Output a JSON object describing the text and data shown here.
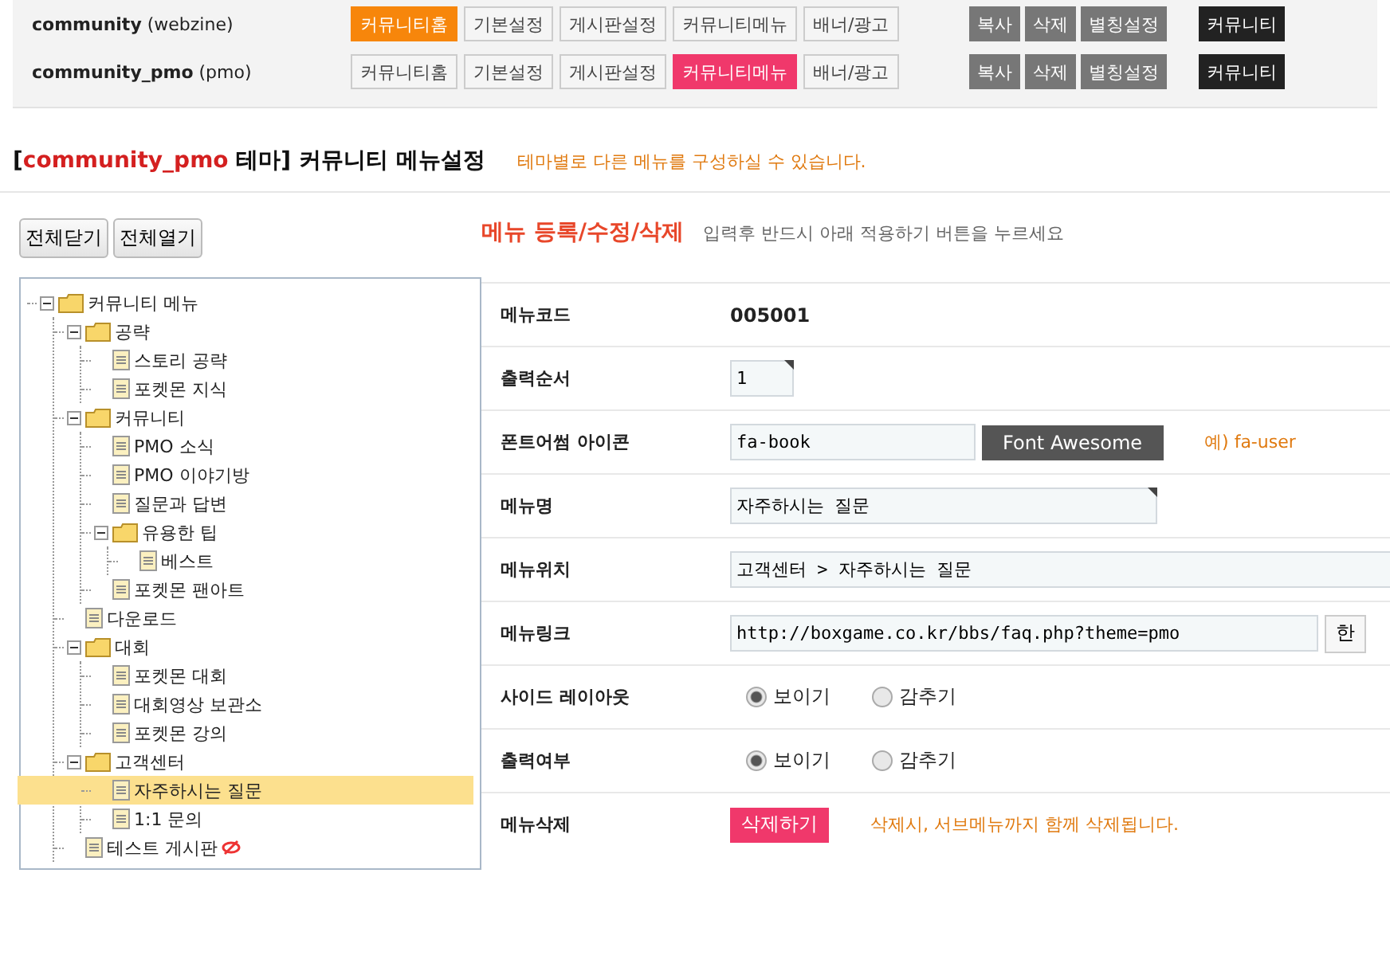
{
  "themes": [
    {
      "name": "community",
      "type": "(webzine)",
      "color": "#f7860b",
      "tabs": [
        {
          "label": "커뮤니티홈",
          "selected": true
        },
        {
          "label": "기본설정",
          "selected": false
        },
        {
          "label": "게시판설정",
          "selected": false
        },
        {
          "label": "커뮤니티메뉴",
          "selected": false
        },
        {
          "label": "배너/광고",
          "selected": false
        }
      ],
      "actions": [
        {
          "label": "복사",
          "kind": "gray"
        },
        {
          "label": "삭제",
          "kind": "gray"
        },
        {
          "label": "별칭설정",
          "kind": "gray"
        },
        {
          "label": "커뮤니티",
          "kind": "dark"
        }
      ]
    },
    {
      "name": "community_pmo",
      "type": "(pmo)",
      "color": "#f0386b",
      "tabs": [
        {
          "label": "커뮤니티홈",
          "selected": false
        },
        {
          "label": "기본설정",
          "selected": false
        },
        {
          "label": "게시판설정",
          "selected": false
        },
        {
          "label": "커뮤니티메뉴",
          "selected": true
        },
        {
          "label": "배너/광고",
          "selected": false
        }
      ],
      "actions": [
        {
          "label": "복사",
          "kind": "gray"
        },
        {
          "label": "삭제",
          "kind": "gray"
        },
        {
          "label": "별칭설정",
          "kind": "gray"
        },
        {
          "label": "커뮤니티",
          "kind": "dark"
        }
      ]
    }
  ],
  "heading": {
    "open": "[",
    "theme": "community_pmo",
    "title": "테마] 커뮤니티 메뉴설정",
    "note": "테마별로 다른 메뉴를 구성하실 수 있습니다."
  },
  "tree_buttons": [
    "전체닫기",
    "전체열기"
  ],
  "tree": [
    {
      "label": "커뮤니티 메뉴",
      "kind": "folder",
      "selected": false,
      "hidden": false,
      "children": [
        {
          "label": "공략",
          "kind": "folder",
          "selected": false,
          "hidden": false,
          "children": [
            {
              "label": "스토리 공략",
              "kind": "page",
              "selected": false,
              "hidden": false
            },
            {
              "label": "포켓몬 지식",
              "kind": "page",
              "selected": false,
              "hidden": false
            }
          ]
        },
        {
          "label": "커뮤니티",
          "kind": "folder",
          "selected": false,
          "hidden": false,
          "children": [
            {
              "label": "PMO 소식",
              "kind": "page",
              "selected": false,
              "hidden": false
            },
            {
              "label": "PMO 이야기방",
              "kind": "page",
              "selected": false,
              "hidden": false
            },
            {
              "label": "질문과 답변",
              "kind": "page",
              "selected": false,
              "hidden": false
            },
            {
              "label": "유용한 팁",
              "kind": "folder",
              "selected": false,
              "hidden": false,
              "children": [
                {
                  "label": "베스트",
                  "kind": "page",
                  "selected": false,
                  "hidden": false
                }
              ]
            },
            {
              "label": "포켓몬 팬아트",
              "kind": "page",
              "selected": false,
              "hidden": false
            }
          ]
        },
        {
          "label": "다운로드",
          "kind": "page",
          "selected": false,
          "hidden": false
        },
        {
          "label": "대회",
          "kind": "folder",
          "selected": false,
          "hidden": false,
          "children": [
            {
              "label": "포켓몬 대회",
              "kind": "page",
              "selected": false,
              "hidden": false
            },
            {
              "label": "대회영상 보관소",
              "kind": "page",
              "selected": false,
              "hidden": false
            },
            {
              "label": "포켓몬 강의",
              "kind": "page",
              "selected": false,
              "hidden": false
            }
          ]
        },
        {
          "label": "고객센터",
          "kind": "folder",
          "selected": false,
          "hidden": false,
          "children": [
            {
              "label": "자주하시는 질문",
              "kind": "page",
              "selected": true,
              "hidden": false
            },
            {
              "label": "1:1 문의",
              "kind": "page",
              "selected": false,
              "hidden": false
            }
          ]
        },
        {
          "label": "테스트 게시판",
          "kind": "page",
          "selected": false,
          "hidden": true
        }
      ]
    }
  ],
  "form": {
    "title": "메뉴 등록/수정/삭제",
    "hint": "입력후 반드시 아래 적용하기 버튼을 누르세요",
    "rows": [
      {
        "label": "메뉴코드",
        "kind": "text",
        "value": "005001"
      },
      {
        "label": "출력순서",
        "kind": "input",
        "value": "1",
        "required": true
      },
      {
        "label": "폰트어썸 아이콘",
        "kind": "input",
        "value": "fa-book",
        "button": "Font Awesome",
        "note": "예) fa-user",
        "required": false
      },
      {
        "label": "메뉴명",
        "kind": "input",
        "value": "자주하시는 질문",
        "required": true
      },
      {
        "label": "메뉴위치",
        "kind": "input",
        "value": "고객센터 > 자주하시는 질문"
      },
      {
        "label": "메뉴링크",
        "kind": "input",
        "value": "http://boxgame.co.kr/bbs/faq.php?theme=pmo",
        "side_button": "한",
        "required": false
      },
      {
        "label": "사이드 레이아웃",
        "kind": "radio",
        "options": [
          {
            "label": "보이기",
            "selected": true
          },
          {
            "label": "감추기",
            "selected": false
          }
        ]
      },
      {
        "label": "출력여부",
        "kind": "radio",
        "options": [
          {
            "label": "보이기",
            "selected": true
          },
          {
            "label": "감추기",
            "selected": false
          }
        ]
      },
      {
        "label": "메뉴삭제",
        "kind": "delete",
        "button": "삭제하기",
        "note": "삭제시, 서브메뉴까지 함께 삭제됩니다."
      }
    ]
  }
}
